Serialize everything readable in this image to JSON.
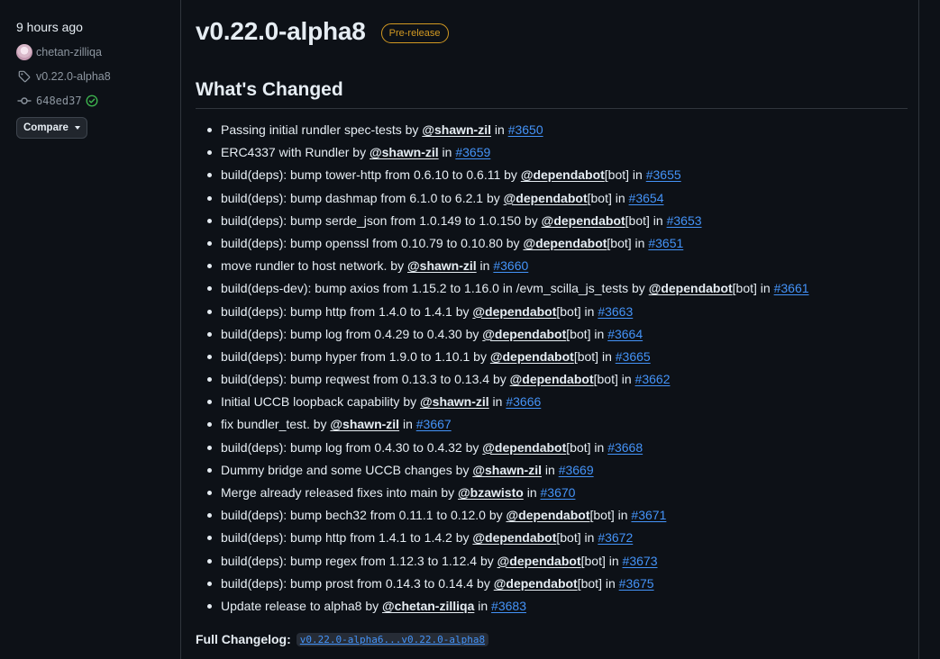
{
  "sidebar": {
    "time": "9 hours ago",
    "author": "chetan-zilliqa",
    "tag": "v0.22.0-alpha8",
    "commit": "648ed37",
    "compare_label": "Compare"
  },
  "release": {
    "title": "v0.22.0-alpha8",
    "badge": "Pre-release",
    "section_title": "What's Changed",
    "changes": [
      {
        "text": "Passing initial rundler spec-tests by ",
        "user": "@shawn-zil",
        "bot": "",
        "pr": "#3650"
      },
      {
        "text": "ERC4337 with Rundler by ",
        "user": "@shawn-zil",
        "bot": "",
        "pr": "#3659"
      },
      {
        "text": "build(deps): bump tower-http from 0.6.10 to 0.6.11 by ",
        "user": "@dependabot",
        "bot": "[bot]",
        "pr": "#3655"
      },
      {
        "text": "build(deps): bump dashmap from 6.1.0 to 6.2.1 by ",
        "user": "@dependabot",
        "bot": "[bot]",
        "pr": "#3654"
      },
      {
        "text": "build(deps): bump serde_json from 1.0.149 to 1.0.150 by ",
        "user": "@dependabot",
        "bot": "[bot]",
        "pr": "#3653"
      },
      {
        "text": "build(deps): bump openssl from 0.10.79 to 0.10.80 by ",
        "user": "@dependabot",
        "bot": "[bot]",
        "pr": "#3651"
      },
      {
        "text": "move rundler to host network. by ",
        "user": "@shawn-zil",
        "bot": "",
        "pr": "#3660"
      },
      {
        "text": "build(deps-dev): bump axios from 1.15.2 to 1.16.0 in /evm_scilla_js_tests by ",
        "user": "@dependabot",
        "bot": "[bot]",
        "pr": "#3661"
      },
      {
        "text": "build(deps): bump http from 1.4.0 to 1.4.1 by ",
        "user": "@dependabot",
        "bot": "[bot]",
        "pr": "#3663"
      },
      {
        "text": "build(deps): bump log from 0.4.29 to 0.4.30 by ",
        "user": "@dependabot",
        "bot": "[bot]",
        "pr": "#3664"
      },
      {
        "text": "build(deps): bump hyper from 1.9.0 to 1.10.1 by ",
        "user": "@dependabot",
        "bot": "[bot]",
        "pr": "#3665"
      },
      {
        "text": "build(deps): bump reqwest from 0.13.3 to 0.13.4 by ",
        "user": "@dependabot",
        "bot": "[bot]",
        "pr": "#3662"
      },
      {
        "text": "Initial UCCB loopback capability by ",
        "user": "@shawn-zil",
        "bot": "",
        "pr": "#3666"
      },
      {
        "text": "fix bundler_test. by ",
        "user": "@shawn-zil",
        "bot": "",
        "pr": "#3667"
      },
      {
        "text": "build(deps): bump log from 0.4.30 to 0.4.32 by ",
        "user": "@dependabot",
        "bot": "[bot]",
        "pr": "#3668"
      },
      {
        "text": "Dummy bridge and some UCCB changes by ",
        "user": "@shawn-zil",
        "bot": "",
        "pr": "#3669"
      },
      {
        "text": "Merge already released fixes into main by ",
        "user": "@bzawisto",
        "bot": "",
        "pr": "#3670"
      },
      {
        "text": "build(deps): bump bech32 from 0.11.1 to 0.12.0 by ",
        "user": "@dependabot",
        "bot": "[bot]",
        "pr": "#3671"
      },
      {
        "text": "build(deps): bump http from 1.4.1 to 1.4.2 by ",
        "user": "@dependabot",
        "bot": "[bot]",
        "pr": "#3672"
      },
      {
        "text": "build(deps): bump regex from 1.12.3 to 1.12.4 by ",
        "user": "@dependabot",
        "bot": "[bot]",
        "pr": "#3673"
      },
      {
        "text": "build(deps): bump prost from 0.14.3 to 0.14.4 by ",
        "user": "@dependabot",
        "bot": "[bot]",
        "pr": "#3675"
      },
      {
        "text": "Update release to alpha8 by ",
        "user": "@chetan-zilliqa",
        "bot": "",
        "pr": "#3683"
      }
    ],
    "in_word": " in ",
    "changelog_label": "Full Changelog",
    "changelog_colon": ": ",
    "changelog_link": "v0.22.0-alpha6...v0.22.0-alpha8"
  },
  "colors": {
    "background": "#0d1117",
    "link": "#4493f8",
    "prerelease": "#d29922",
    "success": "#3fb950"
  },
  "icons": {
    "tag": "tag-icon",
    "commit": "git-commit-icon",
    "verified": "check-circle-icon",
    "dropdown": "caret-down-icon"
  }
}
